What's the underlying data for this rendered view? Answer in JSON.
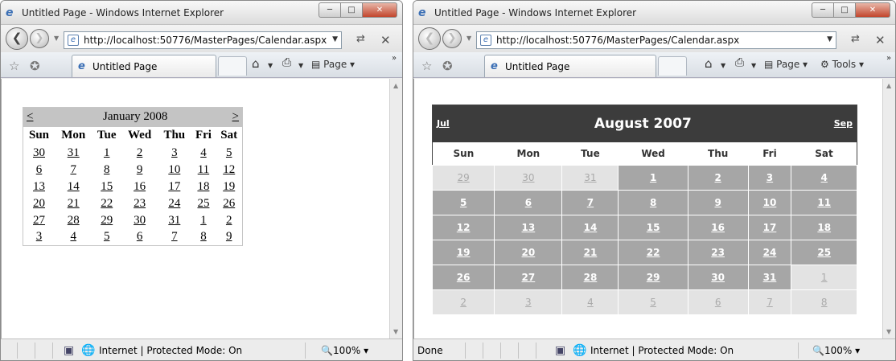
{
  "left_window": {
    "title": "Untitled Page - Windows Internet Explorer",
    "address": "http://localhost:50776/MasterPages/Calendar.aspx",
    "tab_label": "Untitled Page",
    "page_menu": "Page",
    "status_zone": "Internet | Protected Mode: On",
    "zoom": "100%",
    "calendar": {
      "prev": "<",
      "next": ">",
      "month": "January 2008",
      "weekdays": [
        "Sun",
        "Mon",
        "Tue",
        "Wed",
        "Thu",
        "Fri",
        "Sat"
      ],
      "weeks": [
        [
          "30",
          "31",
          "1",
          "2",
          "3",
          "4",
          "5"
        ],
        [
          "6",
          "7",
          "8",
          "9",
          "10",
          "11",
          "12"
        ],
        [
          "13",
          "14",
          "15",
          "16",
          "17",
          "18",
          "19"
        ],
        [
          "20",
          "21",
          "22",
          "23",
          "24",
          "25",
          "26"
        ],
        [
          "27",
          "28",
          "29",
          "30",
          "31",
          "1",
          "2"
        ],
        [
          "3",
          "4",
          "5",
          "6",
          "7",
          "8",
          "9"
        ]
      ]
    }
  },
  "right_window": {
    "title": "Untitled Page - Windows Internet Explorer",
    "address": "http://localhost:50776/MasterPages/Calendar.aspx",
    "tab_label": "Untitled Page",
    "page_menu": "Page",
    "tools_menu": "Tools",
    "status_done": "Done",
    "status_zone": "Internet | Protected Mode: On",
    "zoom": "100%",
    "calendar": {
      "prev": "Jul",
      "next": "Sep",
      "month": "August 2007",
      "weekdays": [
        "Sun",
        "Mon",
        "Tue",
        "Wed",
        "Thu",
        "Fri",
        "Sat"
      ],
      "weeks": [
        [
          "29",
          "30",
          "31",
          "1",
          "2",
          "3",
          "4"
        ],
        [
          "5",
          "6",
          "7",
          "8",
          "9",
          "10",
          "11"
        ],
        [
          "12",
          "13",
          "14",
          "15",
          "16",
          "17",
          "18"
        ],
        [
          "19",
          "20",
          "21",
          "22",
          "23",
          "24",
          "25"
        ],
        [
          "26",
          "27",
          "28",
          "29",
          "30",
          "31",
          "1"
        ],
        [
          "2",
          "3",
          "4",
          "5",
          "6",
          "7",
          "8"
        ]
      ],
      "out_of_month": [
        [
          true,
          true,
          true,
          false,
          false,
          false,
          false
        ],
        [
          false,
          false,
          false,
          false,
          false,
          false,
          false
        ],
        [
          false,
          false,
          false,
          false,
          false,
          false,
          false
        ],
        [
          false,
          false,
          false,
          false,
          false,
          false,
          false
        ],
        [
          false,
          false,
          false,
          false,
          false,
          false,
          true
        ],
        [
          true,
          true,
          true,
          true,
          true,
          true,
          true
        ]
      ]
    }
  },
  "icons": {
    "ie": "ie-page-icon",
    "back": "back-arrow-icon",
    "forward": "forward-arrow-icon",
    "refresh": "refresh-icon",
    "stop": "stop-icon",
    "favorites": "favorites-star-icon",
    "add_favorites": "add-favorites-icon",
    "home": "home-icon",
    "print": "print-icon",
    "globe": "globe-icon"
  }
}
